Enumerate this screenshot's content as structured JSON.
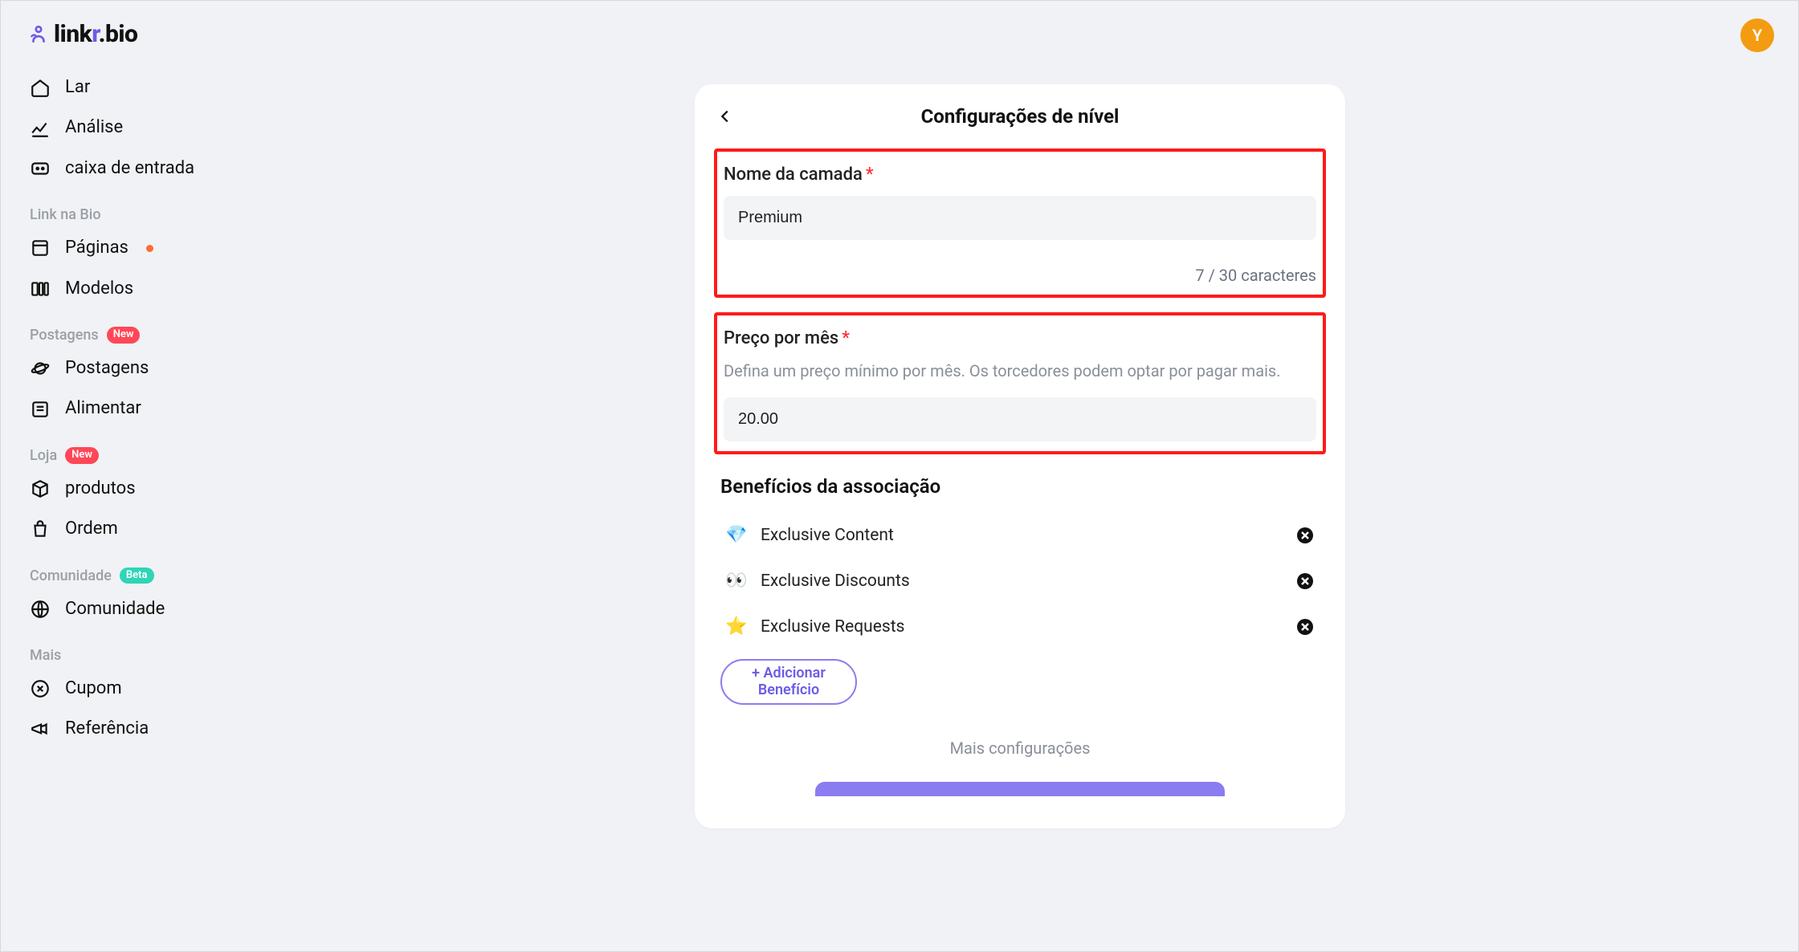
{
  "brand": {
    "part1": "link",
    "part2": "r",
    "part3": ".bio"
  },
  "avatar": {
    "initial": "Y"
  },
  "sidebar": {
    "top": [
      {
        "label": "Lar",
        "name": "nav-home"
      },
      {
        "label": "Análise",
        "name": "nav-analytics"
      },
      {
        "label": "caixa de entrada",
        "name": "nav-inbox"
      }
    ],
    "groups": [
      {
        "header": "Link na Bio",
        "header_badge": null,
        "items": [
          {
            "label": "Páginas",
            "name": "nav-pages",
            "dot": true
          },
          {
            "label": "Modelos",
            "name": "nav-templates"
          }
        ]
      },
      {
        "header": "Postagens",
        "header_badge": {
          "text": "New",
          "variant": "red"
        },
        "items": [
          {
            "label": "Postagens",
            "name": "nav-posts"
          },
          {
            "label": "Alimentar",
            "name": "nav-feed"
          }
        ]
      },
      {
        "header": "Loja",
        "header_badge": {
          "text": "New",
          "variant": "red"
        },
        "items": [
          {
            "label": "produtos",
            "name": "nav-products"
          },
          {
            "label": "Ordem",
            "name": "nav-orders"
          }
        ]
      },
      {
        "header": "Comunidade",
        "header_badge": {
          "text": "Beta",
          "variant": "teal"
        },
        "items": [
          {
            "label": "Comunidade",
            "name": "nav-community"
          }
        ]
      },
      {
        "header": "Mais",
        "header_badge": null,
        "items": [
          {
            "label": "Cupom",
            "name": "nav-coupon"
          },
          {
            "label": "Referência",
            "name": "nav-referral"
          }
        ]
      }
    ]
  },
  "page": {
    "title": "Configurações de nível",
    "tier_name": {
      "label": "Nome da camada",
      "value": "Premium",
      "counter": "7 / 30 caracteres"
    },
    "price": {
      "label": "Preço por mês",
      "hint": "Defina um preço mínimo por mês. Os torcedores podem optar por pagar mais.",
      "value": "20.00"
    },
    "benefits": {
      "title": "Benefícios da associação",
      "items": [
        {
          "emoji": "💎",
          "label": "Exclusive Content"
        },
        {
          "emoji": "👀",
          "label": "Exclusive Discounts"
        },
        {
          "emoji": "⭐",
          "label": "Exclusive Requests"
        }
      ],
      "add_label": "+ Adicionar Benefício"
    },
    "more_label": "Mais configurações"
  }
}
